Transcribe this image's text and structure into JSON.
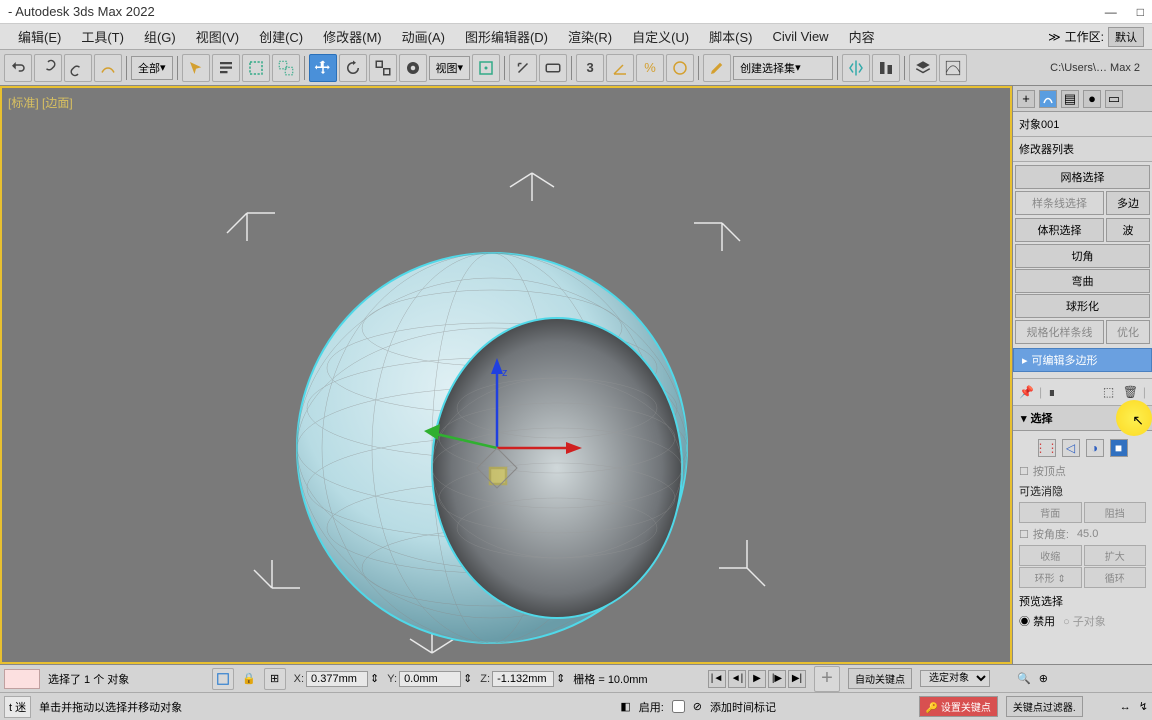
{
  "titlebar": {
    "title": "- Autodesk 3ds Max 2022"
  },
  "menu": {
    "edit": "编辑(E)",
    "tools": "工具(T)",
    "group": "组(G)",
    "views": "视图(V)",
    "create": "创建(C)",
    "modifiers": "修改器(M)",
    "animation": "动画(A)",
    "graph": "图形编辑器(D)",
    "rendering": "渲染(R)",
    "customize": "自定义(U)",
    "scripting": "脚本(S)",
    "civil": "Civil View",
    "content": "内容",
    "workspace_label": "工作区:",
    "workspace_value": "默认"
  },
  "toolbar": {
    "all_label": "全部",
    "view_label": "视图",
    "selection_set": "创建选择集",
    "path": "C:\\Users\\… Max 2"
  },
  "viewport": {
    "label": "[标准] [边面]"
  },
  "panel": {
    "object_name": "对象001",
    "modifier_list_label": "修改器列表",
    "mods": {
      "mesh_select": "网格选择",
      "spline_select": "样条线选择",
      "multi": "多边",
      "vol_select": "体积选择",
      "wave": "波",
      "chamfer": "切角",
      "bend": "弯曲",
      "spherify": "球形化",
      "normalize": "规格化样条线",
      "opt": "优化"
    },
    "stack_item": "可编辑多边形",
    "rollout_select": "选择",
    "by_vertex": "按顶点",
    "ignore_backfacing": "可选消隐",
    "backface": "背面",
    "block": "阻挡",
    "by_angle": "按角度:",
    "angle_value": "45.0",
    "shrink": "收缩",
    "grow": "扩大",
    "ring": "环形",
    "loop": "循环",
    "preview_label": "预览选择",
    "disable": "禁用",
    "sub_object": "子对象"
  },
  "status": {
    "selection": "选择了 1 个 对象",
    "x_val": "0.377mm",
    "y_val": "0.0mm",
    "z_val": "-1.132mm",
    "grid": "栅格 = 10.0mm",
    "auto_key": "自动关键点",
    "selected_obj": "选定对象",
    "mini": "t 迷",
    "prompt": "单击并拖动以选择并移动对象",
    "enable": "启用:",
    "add_time": "添加时间标记",
    "set_key": "设置关键点",
    "key_filter": "关键点过滤器."
  }
}
